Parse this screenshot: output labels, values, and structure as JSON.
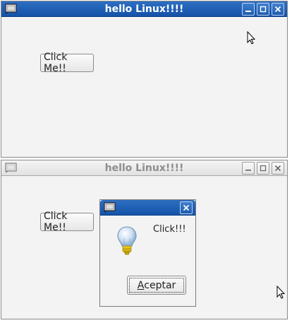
{
  "window1": {
    "title": "hello Linux!!!!",
    "button_label": "Click Me!!",
    "state": "active"
  },
  "background_strip_text": "     ' - - ' ' - - ' ' - - -  ' ' ' - - -    ' - -  ' '  ' - - - - ' ",
  "window2": {
    "title": "hello Linux!!!!",
    "button_label": "Click Me!!",
    "state": "inactive"
  },
  "dialog": {
    "message": "Click!!!",
    "ok_label_prefix": "",
    "ok_label_mnemonic": "A",
    "ok_label_rest": "ceptar",
    "icon": "lightbulb-info-icon"
  },
  "colors": {
    "active_title": "#1452a8",
    "window_bg": "#f3f3f3"
  }
}
